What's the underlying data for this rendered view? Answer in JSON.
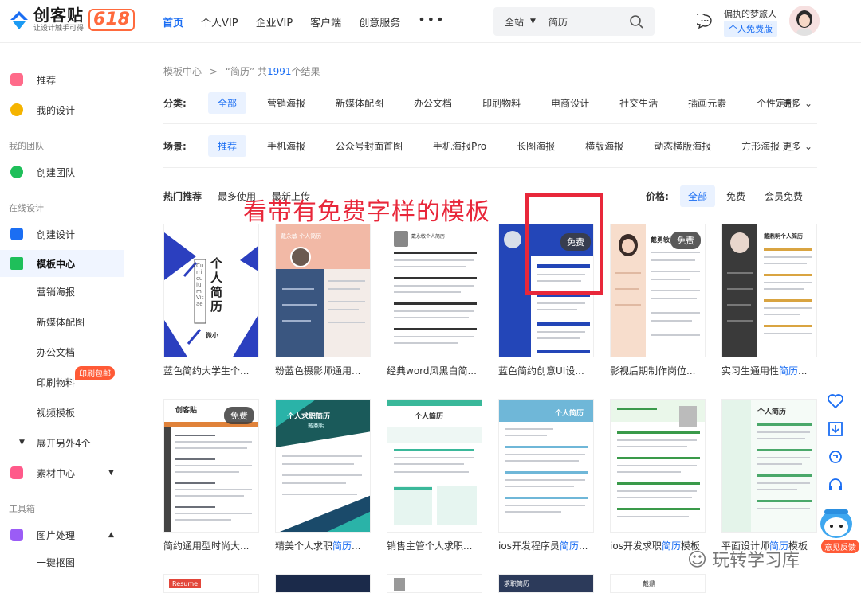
{
  "header": {
    "logo_name": "创客贴",
    "logo_slogan": "让设计触手可得",
    "logo_promo": "618",
    "nav": [
      "首页",
      "个人VIP",
      "企业VIP",
      "客户端",
      "创意服务"
    ],
    "nav_more": "•••",
    "search": {
      "scope": "全站",
      "value": "简历"
    },
    "user_name": "偏执的梦旅人",
    "user_badge": "个人免费版"
  },
  "sidebar": {
    "items": [
      {
        "label": "推荐",
        "icon": "thumbs-up-icon",
        "color": "#ff6b8a"
      },
      {
        "label": "我的设计",
        "icon": "lightbulb-icon",
        "color": "#f5b400"
      }
    ],
    "group_team": "我的团队",
    "create_team": "创建团队",
    "group_online": "在线设计",
    "create_design": "创建设计",
    "template_center": "模板中心",
    "sub_items": [
      "营销海报",
      "新媒体配图",
      "办公文档",
      "印刷物料",
      "视频模板"
    ],
    "print_badge": "印刷包邮",
    "expand_more": "展开另外4个",
    "material_center": "素材中心",
    "group_tools": "工具箱",
    "image_process": "图片处理",
    "one_key_cutout": "一键抠图"
  },
  "main": {
    "breadcrumb_root": "模板中心",
    "breadcrumb_sep": ">",
    "breadcrumb_query": "“简历” 共",
    "breadcrumb_count": "1991",
    "breadcrumb_tail": "个结果",
    "category_label": "分类:",
    "categories": [
      "全部",
      "营销海报",
      "新媒体配图",
      "办公文档",
      "印刷物料",
      "电商设计",
      "社交生活",
      "插画元素",
      "个性定制"
    ],
    "scene_label": "场景:",
    "scenes": [
      "推荐",
      "手机海报",
      "公众号封面首图",
      "手机海报Pro",
      "长图海报",
      "横版海报",
      "动态横版海报",
      "方形海报"
    ],
    "more_label": "更多",
    "sorts": [
      "热门推荐",
      "最多使用",
      "最新上传"
    ],
    "price_label": "价格:",
    "prices": [
      "全部",
      "免费",
      "会员免费"
    ],
    "annotation": "看带有免费字样的模板",
    "free_tag": "免费"
  },
  "cards": [
    {
      "title": "蓝色简约大学生个...",
      "free": false
    },
    {
      "title": "粉蓝色摄影师通用...",
      "free": false
    },
    {
      "title": "经典word风黑白简...",
      "free": false
    },
    {
      "title": "蓝色简约创意UI设...",
      "free": true
    },
    {
      "title": "影视后期制作岗位...",
      "free": true
    },
    {
      "title_pre": "实习生通用性",
      "title_hl": "简历",
      "title_post": "...",
      "free": false
    },
    {
      "title": "简约通用型时尚大...",
      "free": true
    },
    {
      "title_pre": "精美个人求职",
      "title_hl": "简历",
      "title_post": "...",
      "free": false
    },
    {
      "title": "销售主管个人求职...",
      "free": false
    },
    {
      "title_pre": "ios开发程序员",
      "title_hl": "简历",
      "title_post": "...",
      "free": false
    },
    {
      "title_pre": "ios开发求职",
      "title_hl": "简历",
      "title_post": "模板",
      "free": false
    },
    {
      "title_pre": "平面设计师",
      "title_hl": "简历",
      "title_post": "模板",
      "free": false
    }
  ],
  "thumb_text": {
    "c1_title": "个人简历",
    "c1_sub": "Curriculum Vitae",
    "c1_name": "微小",
    "c2_title": "戴永敏 个人简历",
    "c3_title": "戴永敏个人简历",
    "c5_name": "戴勇敏",
    "c6_title": "戴鼎明个人简历",
    "c7_title": "创客贴",
    "c8_title": "个人求职简历",
    "c8_sub": "戴鼎明",
    "c9_title": "个人简历",
    "c10_title": "个人简历",
    "c12_title": "个人简历",
    "r3_b1": "Resume",
    "r3_b4": "求职简历",
    "r3_b5": "戴鼎"
  },
  "float": {
    "feedback": "意见反馈",
    "watermark": "玩转学习库"
  },
  "colors": {
    "accent": "#1b6ef3",
    "annotation": "#e8273a",
    "badge": "#ff5a36"
  }
}
